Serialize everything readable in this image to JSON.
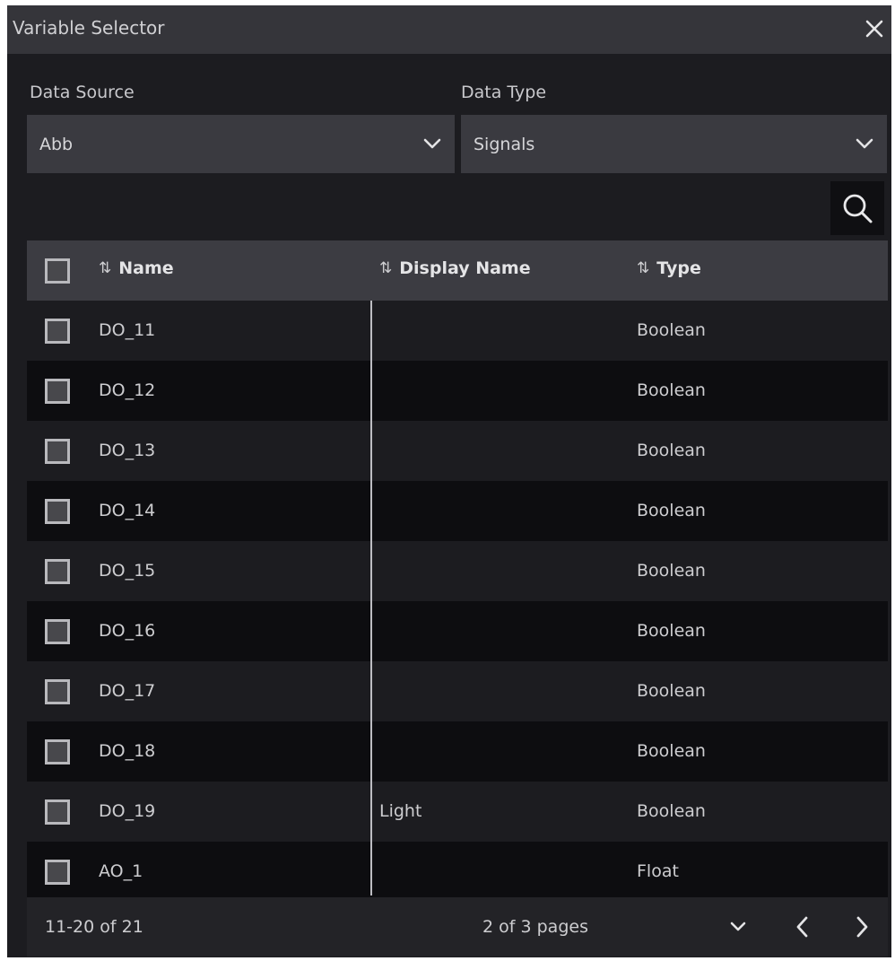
{
  "window": {
    "title": "Variable Selector"
  },
  "filters": {
    "data_source_label": "Data Source",
    "data_source_value": "Abb",
    "data_type_label": "Data Type",
    "data_type_value": "Signals"
  },
  "table": {
    "headers": {
      "name": "Name",
      "display_name": "Display Name",
      "type": "Type"
    },
    "rows": [
      {
        "name": "DO_11",
        "display_name": "",
        "type": "Boolean"
      },
      {
        "name": "DO_12",
        "display_name": "",
        "type": "Boolean"
      },
      {
        "name": "DO_13",
        "display_name": "",
        "type": "Boolean"
      },
      {
        "name": "DO_14",
        "display_name": "",
        "type": "Boolean"
      },
      {
        "name": "DO_15",
        "display_name": "",
        "type": "Boolean"
      },
      {
        "name": "DO_16",
        "display_name": "",
        "type": "Boolean"
      },
      {
        "name": "DO_17",
        "display_name": "",
        "type": "Boolean"
      },
      {
        "name": "DO_18",
        "display_name": "",
        "type": "Boolean"
      },
      {
        "name": "DO_19",
        "display_name": "Light",
        "type": "Boolean"
      },
      {
        "name": "AO_1",
        "display_name": "",
        "type": "Float"
      }
    ]
  },
  "pagination": {
    "range": "11-20 of 21",
    "pages": "2 of 3 pages"
  },
  "icons": {
    "close": "close-icon",
    "dropdown": "chevron-down-icon",
    "search": "search-icon",
    "sort": "sort-icon",
    "prev": "chevron-left-icon",
    "next": "chevron-right-icon"
  },
  "colors": {
    "background": "#1c1c20",
    "titlebar": "#35353a",
    "dropdown": "#3a3a40",
    "header": "#3c3c42",
    "row_alt": "#0d0d10"
  }
}
